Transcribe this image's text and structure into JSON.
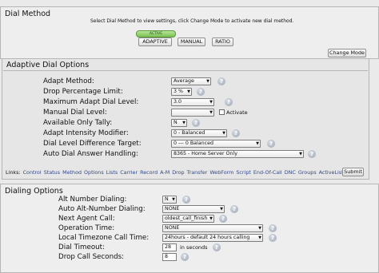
{
  "dial_method": {
    "title": "Dial Method",
    "instruction": "Select Dial Method to view settings, click Change Mode to activate new dial method.",
    "active_badge": "ACTIVE",
    "modes": [
      "ADAPTIVE",
      "MANUAL",
      "RATIO"
    ],
    "change_mode_label": "Change Mode"
  },
  "adaptive": {
    "title": "Adaptive Dial Options",
    "fields": [
      {
        "label": "Adapt Method:",
        "value": "Average"
      },
      {
        "label": "Drop Percentage Limit:",
        "value": "3 %"
      },
      {
        "label": "Maximum Adapt Dial Level:",
        "value": "3.0"
      },
      {
        "label": "Manual Dial Level:",
        "value": "",
        "checkbox_label": "Activate"
      },
      {
        "label": "Available Only Tally:",
        "value": "N"
      },
      {
        "label": "Adapt Intensity Modifier:",
        "value": "0 - Balanced"
      },
      {
        "label": "Dial Level Difference Target:",
        "value": "0 --- 0 Balanced"
      },
      {
        "label": "Auto Dial Answer Handling:",
        "value": "8365 - Home Server Only"
      }
    ],
    "links_label": "Links:",
    "links": [
      "Control",
      "Status",
      "Method",
      "Options",
      "Lists",
      "Carrier",
      "Record",
      "A-M",
      "Drop",
      "Transfer",
      "WebForm",
      "Script",
      "End-Of-Call",
      "DNC",
      "Groups",
      "ActiveLists"
    ],
    "submit_label": "Submit"
  },
  "dialing": {
    "title": "Dialing Options",
    "fields": [
      {
        "label": "Alt Number Dialing:",
        "value": "N"
      },
      {
        "label": "Auto Alt-Number Dialing:",
        "value": "NONE"
      },
      {
        "label": "Next Agent Call:",
        "value": "oldest_call_finish"
      },
      {
        "label": "Operation Time:",
        "value": "NONE"
      },
      {
        "label": "Local Timezone Call Time:",
        "value": "24hours - default 24 hours calling"
      },
      {
        "label": "Dial Timeout:",
        "value": "28",
        "suffix": "in seconds"
      },
      {
        "label": "Drop Call Seconds:",
        "value": "8"
      }
    ]
  },
  "icons": {
    "help": "?",
    "dropdown": "▼"
  },
  "colors": {
    "active_badge": "#79c152",
    "link": "#334a8c"
  }
}
